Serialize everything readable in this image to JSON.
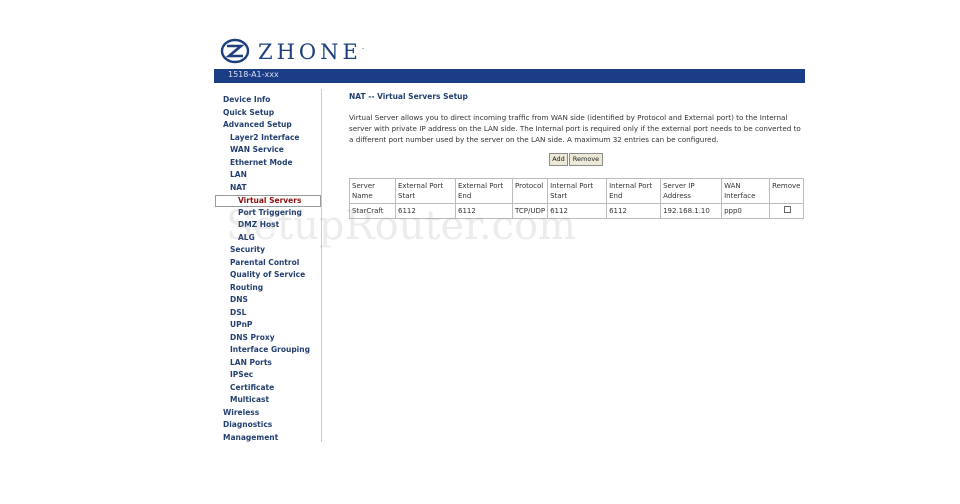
{
  "header": {
    "logo_text": "ZHONE",
    "logo_mark": "·",
    "model": "1518-A1-xxx"
  },
  "nav": [
    {
      "label": "Device Info",
      "level": 0
    },
    {
      "label": "Quick Setup",
      "level": 0
    },
    {
      "label": "Advanced Setup",
      "level": 0
    },
    {
      "label": "Layer2 Interface",
      "level": 1
    },
    {
      "label": "WAN Service",
      "level": 1
    },
    {
      "label": "Ethernet Mode",
      "level": 1
    },
    {
      "label": "LAN",
      "level": 1
    },
    {
      "label": "NAT",
      "level": 1
    },
    {
      "label": "Virtual Servers",
      "level": 2,
      "selected": true
    },
    {
      "label": "Port Triggering",
      "level": 2
    },
    {
      "label": "DMZ Host",
      "level": 2
    },
    {
      "label": "ALG",
      "level": 2
    },
    {
      "label": "Security",
      "level": 1
    },
    {
      "label": "Parental Control",
      "level": 1
    },
    {
      "label": "Quality of Service",
      "level": 1
    },
    {
      "label": "Routing",
      "level": 1
    },
    {
      "label": "DNS",
      "level": 1
    },
    {
      "label": "DSL",
      "level": 1
    },
    {
      "label": "UPnP",
      "level": 1
    },
    {
      "label": "DNS Proxy",
      "level": 1
    },
    {
      "label": "Interface Grouping",
      "level": 1
    },
    {
      "label": "LAN Ports",
      "level": 1
    },
    {
      "label": "IPSec",
      "level": 1
    },
    {
      "label": "Certificate",
      "level": 1
    },
    {
      "label": "Multicast",
      "level": 1
    },
    {
      "label": "Wireless",
      "level": 0
    },
    {
      "label": "Diagnostics",
      "level": 0
    },
    {
      "label": "Management",
      "level": 0
    }
  ],
  "main": {
    "title": "NAT -- Virtual Servers Setup",
    "description": "Virtual Server allows you to direct incoming traffic from WAN side (identified by Protocol and External port) to the Internal server with private IP address on the LAN side. The Internal port is required only if the external port needs to be converted to a different port number used by the server on the LAN side. A maximum 32 entries can be configured.",
    "add_label": "Add",
    "remove_label": "Remove",
    "table": {
      "headers": [
        "Server Name",
        "External Port Start",
        "External Port End",
        "Protocol",
        "Internal Port Start",
        "Internal Port End",
        "Server IP Address",
        "WAN Interface",
        "Remove"
      ],
      "rows": [
        [
          "StarCraft",
          "6112",
          "6112",
          "TCP/UDP",
          "6112",
          "6112",
          "192.168.1.10",
          "ppp0"
        ]
      ]
    }
  },
  "watermark": "SetupRouter.com",
  "colors": {
    "brand_blue": "#1b3d86",
    "nav_text": "#233f70",
    "selected_text": "#8b0f0f"
  }
}
